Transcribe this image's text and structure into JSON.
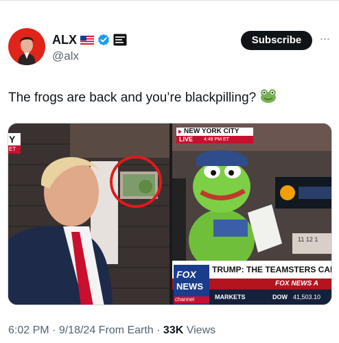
{
  "author": {
    "display_name": "ALX",
    "handle": "@alx",
    "avatar_icon": "person-avatar-icon",
    "flag_icon": "us-flag-icon",
    "verified_icon": "verified-badge-icon",
    "affiliate_icon": "affiliate-badge-icon",
    "accent_color": "#1d9bf0",
    "avatar_color": "#e0241a"
  },
  "actions": {
    "subscribe_label": "Subscribe",
    "more_icon": "more-dots-icon"
  },
  "tweet": {
    "text": "The frogs are back and you’re blackpilling?",
    "emoji_icon": "frog-emoji-icon"
  },
  "media": {
    "left_image": {
      "overlay_letters": "Y",
      "overlay_sub": "ET",
      "highlight_circle_color": "#e01a1a"
    },
    "right_image": {
      "location": "NEW YORK CITY",
      "live_label": "LIVE",
      "time_label": "4:48 PM ET",
      "headline": "TRUMP: THE TEAMSTERS CARI",
      "ticker_network": "FOX NEWS A",
      "network_logo_top": "FOX",
      "network_logo_mid": "NEWS",
      "network_logo_bottom": "channel",
      "markets_label": "MARKETS",
      "dow_label": "DOW",
      "dow_value": "41,503.10",
      "clock_digits": "11  12  1"
    }
  },
  "footer": {
    "time": "6:02 PM",
    "date": "9/18/24",
    "source": "From Earth",
    "views_count": "33K",
    "views_label": "Views"
  }
}
